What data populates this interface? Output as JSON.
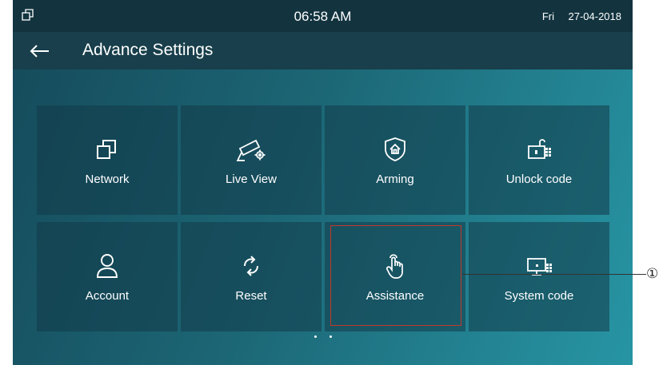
{
  "status_bar": {
    "time": "06:58 AM",
    "day": "Fri",
    "date": "27-04-2018",
    "window_icon": "window-icon"
  },
  "title_bar": {
    "back_icon": "back-arrow-icon",
    "title": "Advance Settings"
  },
  "tiles": [
    {
      "label": "Network",
      "icon": "network-icon"
    },
    {
      "label": "Live View",
      "icon": "camera-gear-icon"
    },
    {
      "label": "Arming",
      "icon": "shield-home-icon"
    },
    {
      "label": "Unlock code",
      "icon": "unlock-keypad-icon"
    },
    {
      "label": "Account",
      "icon": "user-icon"
    },
    {
      "label": "Reset",
      "icon": "refresh-icon"
    },
    {
      "label": "Assistance",
      "icon": "hand-tap-icon"
    },
    {
      "label": "System code",
      "icon": "monitor-keypad-icon"
    }
  ],
  "pagination": {
    "pages": 2,
    "current": 1
  },
  "callout": {
    "marker": "①",
    "color": "#c0392b"
  }
}
